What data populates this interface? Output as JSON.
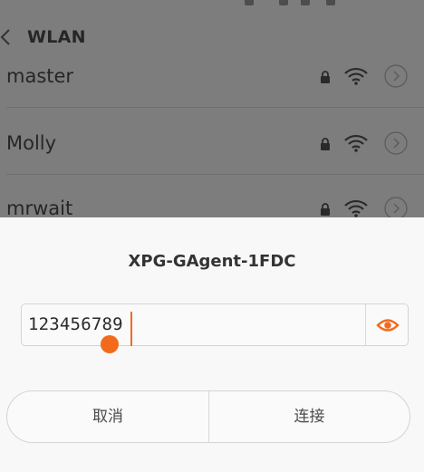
{
  "header": {
    "title": "WLAN",
    "back_icon": "chevron-left-icon"
  },
  "networks": [
    {
      "ssid": "master",
      "secured": true
    },
    {
      "ssid": "Molly",
      "secured": true
    },
    {
      "ssid": "mrwait",
      "secured": true
    }
  ],
  "dialog": {
    "title": "XPG-GAgent-1FDC",
    "password_value": "123456789",
    "show_password_icon": "eye-icon",
    "cancel_label": "取消",
    "connect_label": "连接"
  },
  "colors": {
    "accent": "#f26b1d",
    "overlay": "#7d7d7d",
    "dialog_bg": "#f8f8f8"
  }
}
